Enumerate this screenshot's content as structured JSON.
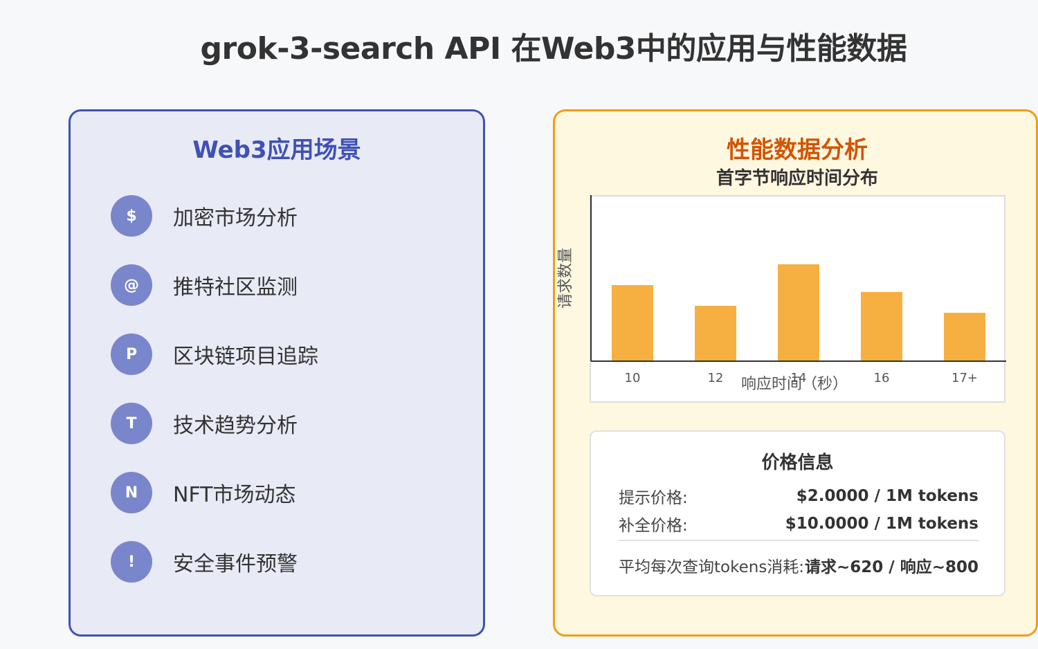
{
  "page": {
    "title": "grok-3-search API 在Web3中的应用与性能数据"
  },
  "left_panel": {
    "title": "Web3应用场景",
    "items": [
      {
        "icon": "$",
        "icon_name": "dollar-icon",
        "label": "加密市场分析"
      },
      {
        "icon": "@",
        "icon_name": "at-icon",
        "label": "推特社区监测"
      },
      {
        "icon": "P",
        "icon_name": "project-icon",
        "label": "区块链项目追踪"
      },
      {
        "icon": "T",
        "icon_name": "trend-icon",
        "label": "技术趋势分析"
      },
      {
        "icon": "N",
        "icon_name": "nft-icon",
        "label": "NFT市场动态"
      },
      {
        "icon": "!",
        "icon_name": "alert-icon",
        "label": "安全事件预警"
      }
    ]
  },
  "right_panel": {
    "title": "性能数据分析",
    "chart_title": "首字节响应时间分布"
  },
  "chart_data": {
    "type": "bar",
    "title": "首字节响应时间分布",
    "xlabel": "响应时间（秒）",
    "ylabel": "请求数量",
    "categories": [
      "10",
      "12",
      "14",
      "16",
      "17+"
    ],
    "values": [
      110,
      80,
      140,
      100,
      70
    ],
    "ylim": [
      0,
      240
    ],
    "grid": false,
    "bar_color": "#f5b041"
  },
  "price_info": {
    "title": "价格信息",
    "prompt_label": "提示价格:",
    "prompt_value": "$2.0000 / 1M tokens",
    "completion_label": "补全价格:",
    "completion_value": "$10.0000 / 1M tokens",
    "avg_label": "平均每次查询tokens消耗:",
    "avg_value": "请求~620 / 响应~800"
  },
  "colors": {
    "left_accent": "#3f51b5",
    "left_bg": "#e8eaf6",
    "icon_bg": "#7986cb",
    "right_accent": "#f39c12",
    "right_bg": "#fff8e1",
    "right_title": "#d35400"
  }
}
